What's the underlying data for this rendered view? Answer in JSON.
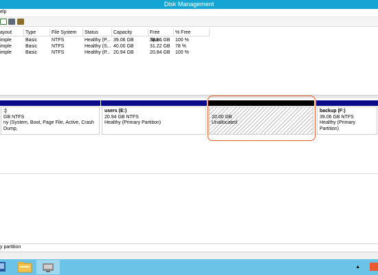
{
  "window": {
    "title": "Disk Management"
  },
  "menu": {
    "item": "elp"
  },
  "toolbar": {
    "icons": [
      "properties-icon",
      "help-icon",
      "refresh-icon"
    ]
  },
  "table": {
    "headers": [
      "ayout",
      "Type",
      "File System",
      "Status",
      "Capacity",
      "Free Spa...",
      "% Free"
    ],
    "rows": [
      [
        "imple",
        "Basic",
        "NTFS",
        "Healthy (P...",
        "39.06 GB",
        "38.96 GB",
        "100 %"
      ],
      [
        "imple",
        "Basic",
        "NTFS",
        "Healthy (S...",
        "40.00 GB",
        "31.22 GB",
        "78 %"
      ],
      [
        "imple",
        "Basic",
        "NTFS",
        "Healthy (P...",
        "20.94 GB",
        "20.84 GB",
        "100 %"
      ]
    ]
  },
  "partitions": [
    {
      "name": ":)",
      "size": "GB NTFS",
      "status": "ny (System, Boot, Page File, Active, Crash Dump,"
    },
    {
      "name": "users  (E:)",
      "size": "20.94 GB NTFS",
      "status": "Healthy (Primary Partition)"
    },
    {
      "name": "",
      "size": "20.00 GB",
      "status": "Unallocated"
    },
    {
      "name": "backup  (F:)",
      "size": "39.06 GB NTFS",
      "status": "Healthy (Primary Partition)"
    }
  ],
  "legend": {
    "label": "y partition"
  },
  "colors": {
    "titlebar": "#15a5d4",
    "taskbar": "#6bc4e8",
    "partition_bar": "#0a0a8a",
    "selection": "#e55a2a"
  }
}
